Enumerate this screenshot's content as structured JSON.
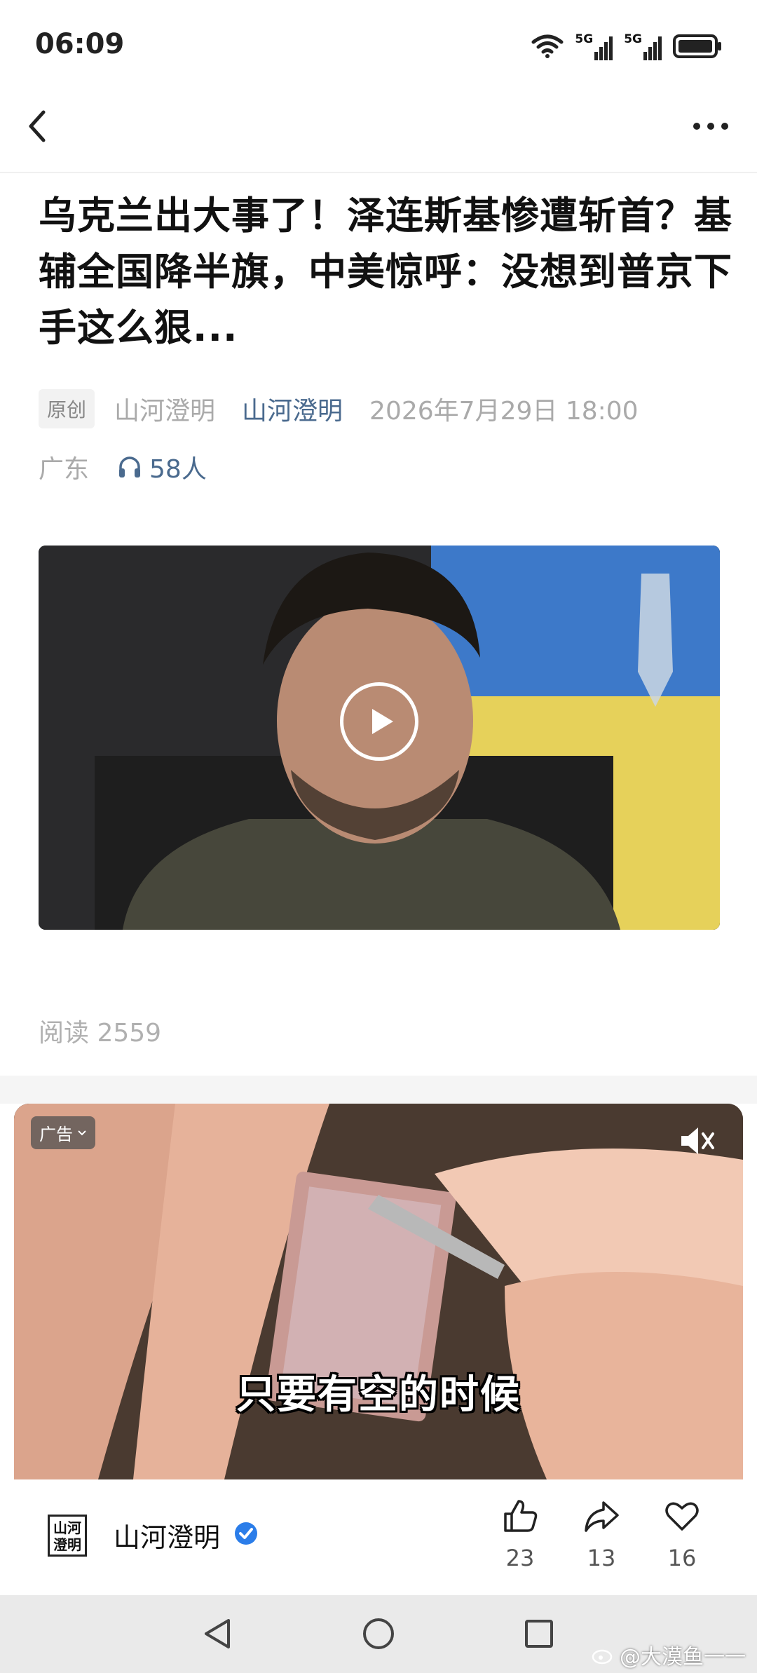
{
  "status_bar": {
    "time": "06:09",
    "net1": "5G",
    "net2": "5G"
  },
  "article": {
    "title": "乌克兰出大事了！泽连斯基惨遭斩首？基辅全国降半旗，中美惊呼：没想到普京下手这么狠...",
    "original_badge": "原创",
    "author": "山河澄明",
    "account": "山河澄明",
    "date": "2026年7月29日 18:00",
    "location": "广东",
    "listeners": "58人",
    "read_label": "阅读 2559"
  },
  "ad": {
    "badge": "广告",
    "subtitle": "只要有空的时候"
  },
  "footer": {
    "account_name": "山河澄明",
    "logo_text": "山河澄明",
    "likes": "23",
    "shares": "13",
    "favorites": "16"
  },
  "watermark": "@大漠鱼一一",
  "icons": [
    "wifi-icon",
    "signal-icon",
    "battery-icon",
    "back-icon",
    "more-icon",
    "headphones-icon",
    "play-icon",
    "mute-icon",
    "verified-icon",
    "thumbs-up-icon",
    "share-icon",
    "heart-icon",
    "nav-back-icon",
    "nav-home-icon",
    "nav-recents-icon"
  ],
  "colors": {
    "link": "#4a6a8e",
    "meta": "#aaaaaa",
    "verified": "#2b7de9"
  }
}
